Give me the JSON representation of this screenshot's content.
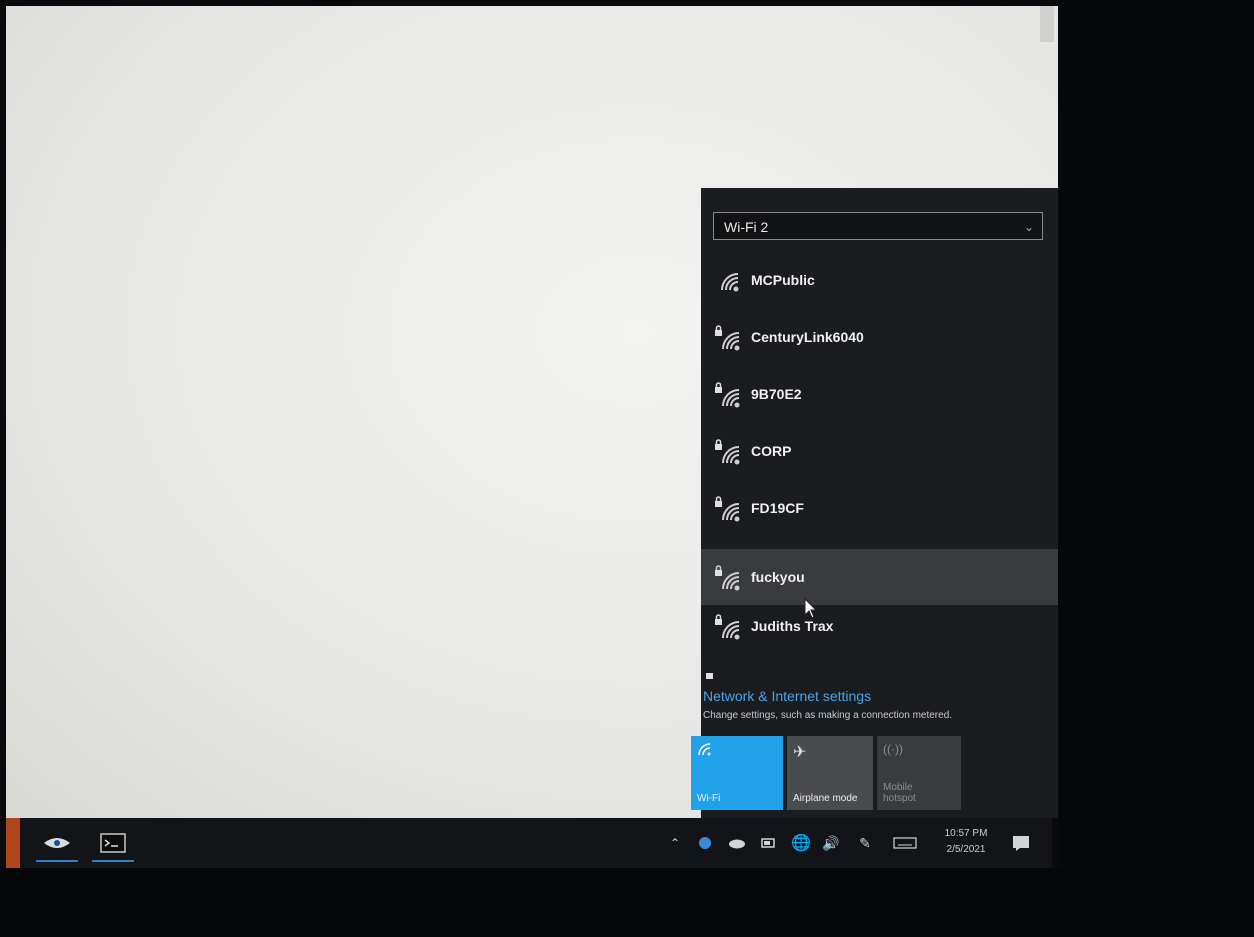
{
  "flyout": {
    "adapter": "Wi-Fi 2",
    "networks": [
      {
        "name": "MCPublic",
        "secured": false
      },
      {
        "name": "CenturyLink6040",
        "secured": true
      },
      {
        "name": "9B70E2",
        "secured": true
      },
      {
        "name": "CORP",
        "secured": true
      },
      {
        "name": "FD19CF",
        "secured": true
      },
      {
        "name": "fuckyou",
        "secured": true
      },
      {
        "name": "Judiths Trax",
        "secured": true
      }
    ],
    "settings_link": "Network & Internet settings",
    "settings_sub": "Change settings, such as making a connection metered.",
    "tiles": {
      "wifi": "Wi-Fi",
      "airplane": "Airplane mode",
      "hotspot": "Mobile hotspot"
    }
  },
  "clock": {
    "time": "10:57 PM",
    "date": "2/5/2021"
  },
  "colors": {
    "accent": "#22a2e8",
    "link": "#4aa3e6",
    "flyout_bg": "#1b1c1f",
    "taskbar_bg": "#131418"
  },
  "icons": [
    "wifi-signal-icon",
    "lock-icon",
    "chevron-down-icon",
    "airplane-icon",
    "hotspot-icon",
    "show-hidden-icons-chevron",
    "battery-icon",
    "globe-icon",
    "volume-icon",
    "pen-icon",
    "keyboard-icon",
    "action-center-icon"
  ]
}
